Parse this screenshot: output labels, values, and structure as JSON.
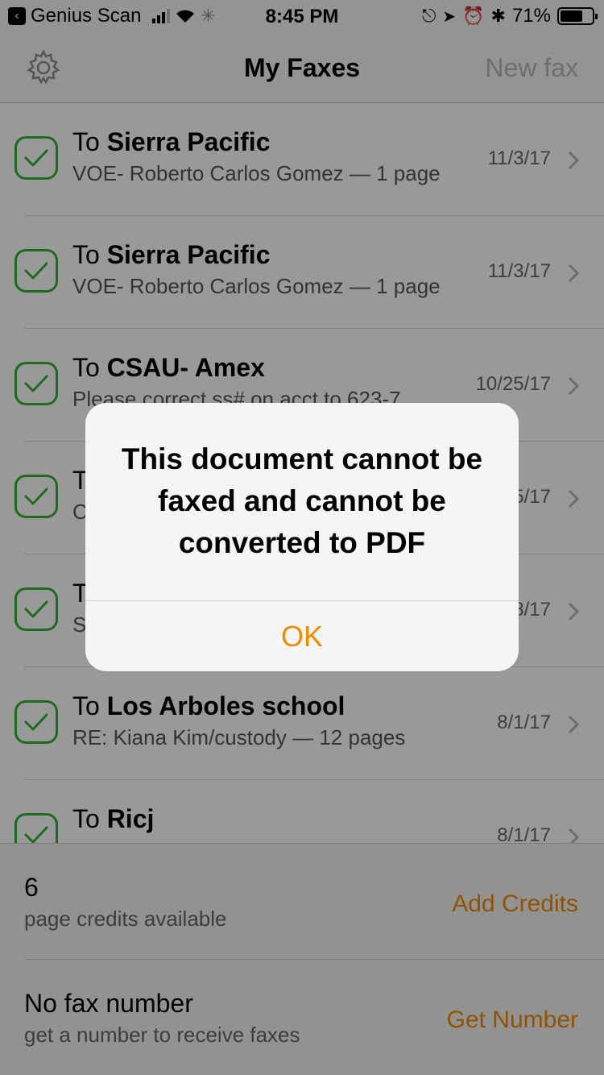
{
  "status_bar": {
    "back_app": "Genius Scan",
    "time": "8:45 PM",
    "battery_percent": "71%",
    "battery_level": 0.71,
    "icons": [
      "signal-bars",
      "wifi",
      "activity-spinner",
      "rotation-lock",
      "location-arrow",
      "alarm",
      "bluetooth",
      "battery"
    ]
  },
  "nav": {
    "title": "My Faxes",
    "new_fax": "New fax",
    "settings_icon": "gear-icon"
  },
  "faxes": [
    {
      "prefix": "To ",
      "recipient": "Sierra Pacific",
      "subtitle": "VOE- Roberto Carlos Gomez — 1 page",
      "date": "11/3/17"
    },
    {
      "prefix": "To ",
      "recipient": "Sierra Pacific",
      "subtitle": "VOE- Roberto Carlos Gomez — 1 page",
      "date": "11/3/17"
    },
    {
      "prefix": "To ",
      "recipient": "CSAU- Amex",
      "subtitle": "Please correct ss# on acct to 623-7",
      "date": "10/25/17"
    },
    {
      "prefix": "T",
      "recipient": "",
      "subtitle": "C",
      "date": "5/17"
    },
    {
      "prefix": "T",
      "recipient": "",
      "subtitle": "S",
      "date": "8/17"
    },
    {
      "prefix": "To ",
      "recipient": "Los Arboles school",
      "subtitle": "RE: Kiana Kim/custody — 12 pages",
      "date": "8/1/17"
    },
    {
      "prefix": "To ",
      "recipient": "Ricj",
      "subtitle": "",
      "date": "8/1/17"
    }
  ],
  "footer": {
    "credits_count": "6",
    "credits_label": "page credits available",
    "add_credits": "Add Credits",
    "fax_title": "No fax number",
    "fax_label": "get a number to receive faxes",
    "get_number": "Get Number"
  },
  "alert": {
    "message": "This document cannot be faxed and cannot be converted to PDF",
    "ok": "OK"
  },
  "colors": {
    "accent": "#f08a00",
    "check": "#2fb52f"
  }
}
